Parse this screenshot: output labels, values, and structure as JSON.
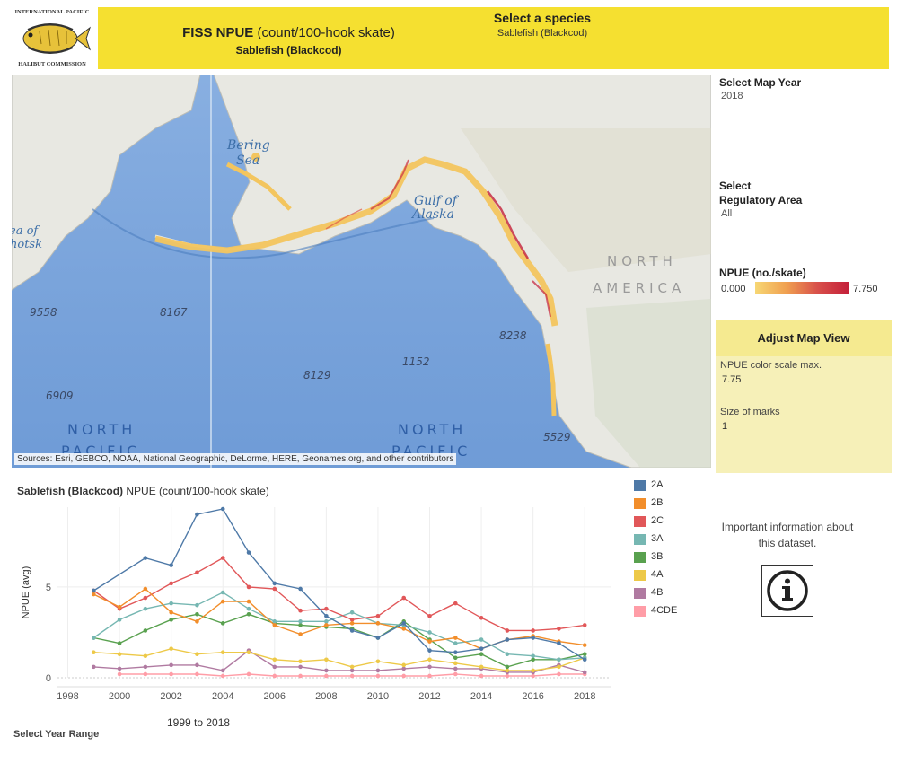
{
  "header": {
    "logo_top": "INTERNATIONAL PACIFIC",
    "logo_bottom": "HALIBUT COMMISSION",
    "title": "FISS NPUE",
    "title_units": "(count/100-hook skate)",
    "subtitle": "Sablefish (Blackcod)",
    "species_label": "Select a species",
    "species_value": "Sablefish (Blackcod)"
  },
  "map": {
    "labels": [
      "Bering",
      "Sea",
      "Gulf of",
      "Alaska",
      "NORTH",
      "AMERICA",
      "NORTH",
      "PACIFIC",
      "NORTH",
      "PACIFIC",
      "ea of",
      "hotsk"
    ],
    "depths": [
      "9558",
      "8167",
      "8129",
      "1152",
      "8238",
      "6909",
      "5529"
    ],
    "attribution": "Sources: Esri, GEBCO, NOAA, National Geographic, DeLorme, HERE, Geonames.org, and other contributors"
  },
  "controls": {
    "map_year_label": "Select Map Year",
    "map_year_value": "2018",
    "reg_area_label1": "Select",
    "reg_area_label2": "Regulatory Area",
    "reg_area_value": "All",
    "npue_label": "NPUE (no./skate)",
    "scale_min": "0.000",
    "scale_max": "7.750",
    "adjust_title": "Adjust Map View",
    "color_max_label": "NPUE color scale max.",
    "color_max_value": "7.75",
    "mark_size_label": "Size of marks",
    "mark_size_value": "1"
  },
  "colors": {
    "banner": "#f5e030",
    "ocean": "#7fa8dd",
    "land": "#e8e8e2",
    "scale_low": "#f7d774",
    "scale_high": "#c4203a"
  },
  "info": {
    "text": "Important information about this dataset."
  },
  "range": {
    "value": "1999 to 2018",
    "label": "Select Year Range"
  },
  "chart_title": {
    "species": "Sablefish (Blackcod)",
    "metric": "NPUE (count/100-hook skate)"
  },
  "chart_data": {
    "type": "line",
    "ylabel": "NPUE (avg)",
    "ylim": [
      0,
      9.4
    ],
    "xlim": [
      1997.6,
      2019
    ],
    "xticks": [
      1998,
      2000,
      2002,
      2004,
      2006,
      2008,
      2010,
      2012,
      2014,
      2016,
      2018
    ],
    "yticks": [
      0,
      5
    ],
    "x": [
      1999,
      2000,
      2001,
      2002,
      2003,
      2004,
      2005,
      2006,
      2007,
      2008,
      2009,
      2010,
      2011,
      2012,
      2013,
      2014,
      2015,
      2016,
      2017,
      2018
    ],
    "series": [
      {
        "name": "2A",
        "color": "#4e79a7",
        "values": [
          4.8,
          null,
          6.6,
          6.2,
          9.0,
          9.3,
          6.9,
          5.2,
          4.9,
          3.4,
          2.6,
          2.2,
          3.0,
          1.5,
          1.4,
          1.6,
          2.1,
          2.2,
          1.9,
          1.0
        ]
      },
      {
        "name": "2B",
        "color": "#f28e2b",
        "values": [
          4.6,
          3.9,
          4.9,
          3.6,
          3.1,
          4.2,
          4.2,
          2.9,
          2.4,
          2.9,
          3.0,
          3.0,
          2.7,
          2.0,
          2.2,
          1.6,
          2.1,
          2.3,
          2.0,
          1.8
        ]
      },
      {
        "name": "2C",
        "color": "#e15759",
        "values": [
          4.8,
          3.8,
          4.4,
          5.2,
          5.8,
          6.6,
          5.0,
          4.9,
          3.7,
          3.8,
          3.2,
          3.4,
          4.4,
          3.4,
          4.1,
          3.3,
          2.6,
          2.6,
          2.7,
          2.9
        ]
      },
      {
        "name": "3A",
        "color": "#76b7b2",
        "values": [
          2.2,
          3.2,
          3.8,
          4.1,
          4.0,
          4.7,
          3.8,
          3.1,
          3.1,
          3.1,
          3.6,
          3.0,
          2.9,
          2.5,
          1.9,
          2.1,
          1.3,
          1.2,
          1.0,
          1.1
        ]
      },
      {
        "name": "3B",
        "color": "#59a14f",
        "values": [
          2.2,
          1.9,
          2.6,
          3.2,
          3.5,
          3.0,
          3.5,
          3.0,
          2.9,
          2.8,
          2.7,
          2.2,
          3.1,
          2.1,
          1.1,
          1.3,
          0.6,
          1.0,
          1.0,
          1.3
        ]
      },
      {
        "name": "4A",
        "color": "#edc948",
        "values": [
          1.4,
          1.3,
          1.2,
          1.6,
          1.3,
          1.4,
          1.4,
          1.0,
          0.9,
          1.0,
          0.6,
          0.9,
          0.7,
          1.0,
          0.8,
          0.6,
          0.4,
          0.4,
          0.6,
          1.1
        ]
      },
      {
        "name": "4B",
        "color": "#b07aa1",
        "values": [
          0.6,
          0.5,
          0.6,
          0.7,
          0.7,
          0.4,
          1.5,
          0.6,
          0.6,
          0.4,
          0.4,
          0.4,
          0.5,
          0.6,
          0.5,
          0.5,
          0.3,
          0.3,
          0.7,
          0.3
        ]
      },
      {
        "name": "4CDE",
        "color": "#ff9da7",
        "values": [
          null,
          0.2,
          0.2,
          0.2,
          0.2,
          0.1,
          0.2,
          0.1,
          0.1,
          0.1,
          0.1,
          0.1,
          0.1,
          0.1,
          0.2,
          0.1,
          0.1,
          0.1,
          0.2,
          0.2
        ]
      }
    ]
  }
}
